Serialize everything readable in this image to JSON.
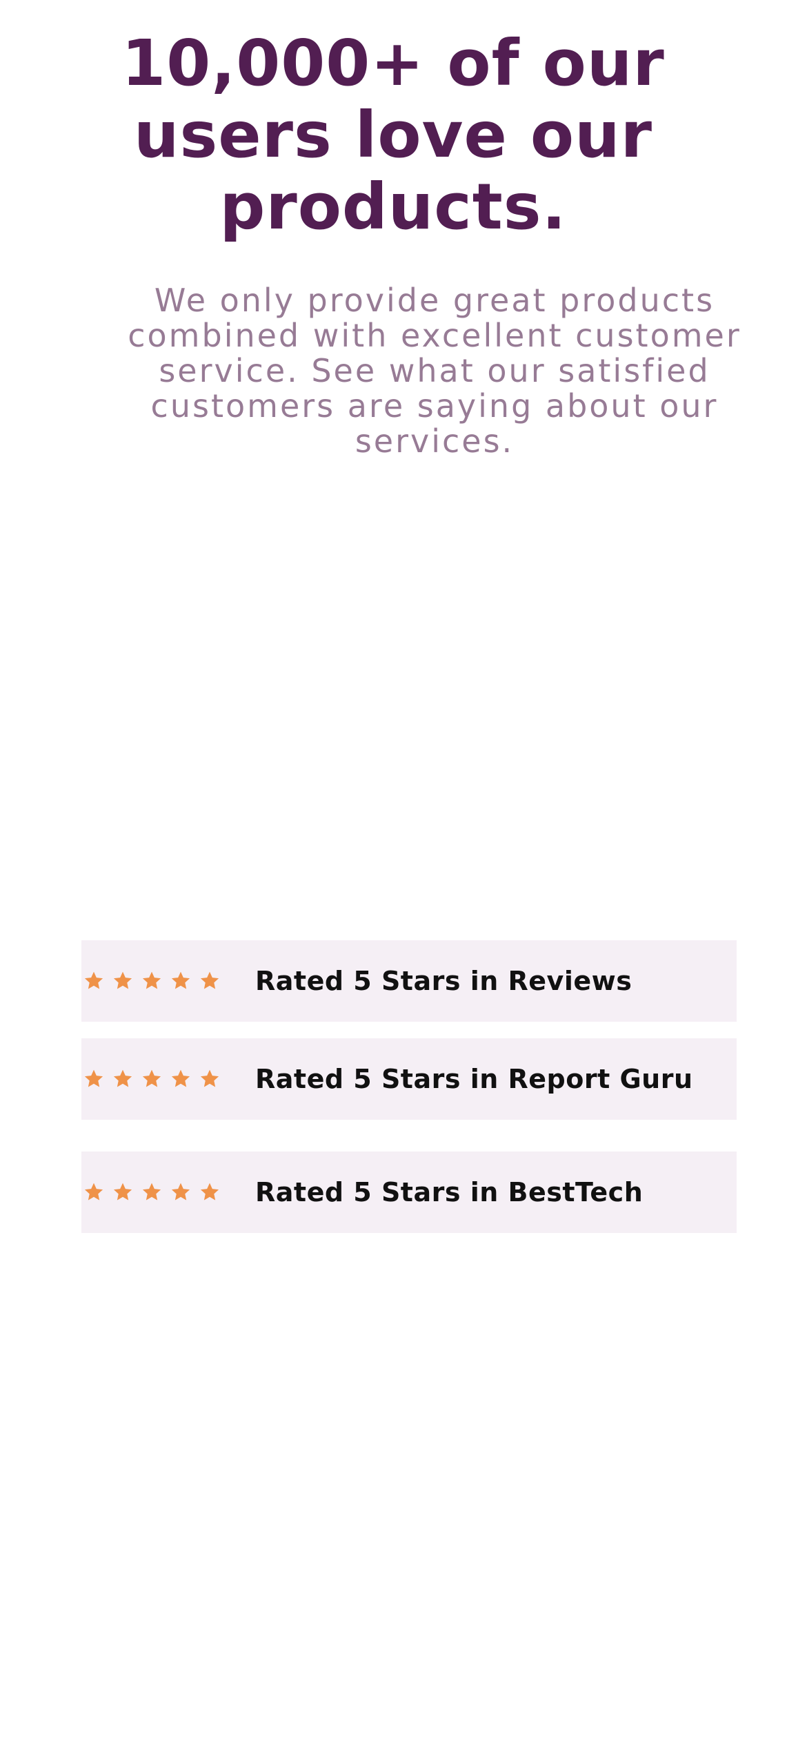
{
  "hero": {
    "headline": "10,000+ of our users love our products.",
    "subtext": "We only provide great products combined with excellent customer service. See what our satisfied customers are saying about our services."
  },
  "ratings": [
    {
      "label": "Rated 5 Stars in Reviews",
      "stars": 5
    },
    {
      "label": "Rated 5 Stars in Report Guru",
      "stars": 5
    },
    {
      "label": "Rated 5 Stars in BestTech",
      "stars": 5
    }
  ],
  "colors": {
    "headline": "#521e52",
    "subtext": "#977b95",
    "star": "#ef9248",
    "rating_background": "#f5eff5",
    "rating_text": "#111111"
  },
  "icons": {
    "star": "star-icon"
  }
}
